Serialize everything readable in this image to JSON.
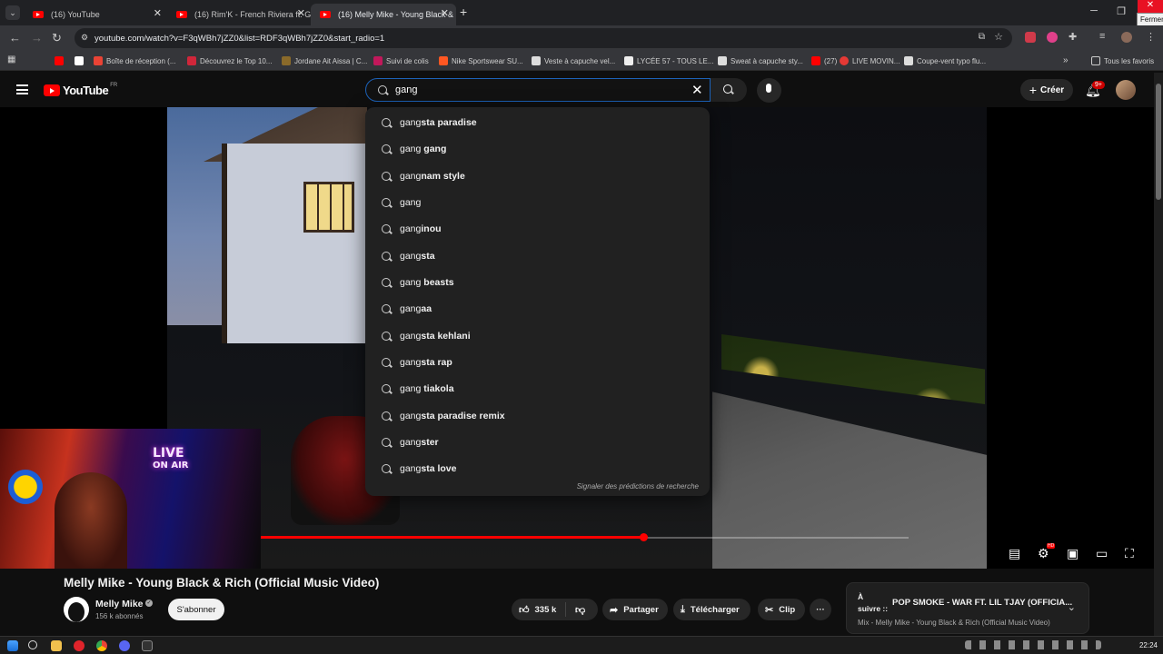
{
  "browser": {
    "tabs": [
      {
        "title": "(16) YouTube"
      },
      {
        "title": "(16) Rim'K - French Riviera ft. G"
      },
      {
        "title": "(16) Melly Mike - Young Black &"
      }
    ],
    "new_tab_symbol": "+",
    "url": "youtube.com/watch?v=F3qWBh7jZZ0&list=RDF3qWBh7jZZ0&start_radio=1",
    "close_tooltip": "Fermer",
    "bookmarks": [
      "Boîte de réception (...",
      "Découvrez le Top 10...",
      "Jordane Ait Aissa | C...",
      "Suivi de colis",
      "Nike Sportswear SU...",
      "Veste à capuche vel...",
      "LYCÉE 57 - TOUS LE...",
      "Sweat à capuche sty...",
      "(27)",
      "LIVE MOVIN...",
      "Coupe-vent typo flu..."
    ],
    "all_bookmarks": "Tous les favoris"
  },
  "youtube": {
    "logo_text": "YouTube",
    "country_code": "FR",
    "search": {
      "query": "gang",
      "suggestions": [
        {
          "typed": "gang",
          "rest": "sta paradise"
        },
        {
          "typed": "gang",
          "rest": " gang"
        },
        {
          "typed": "gang",
          "rest": "nam style"
        },
        {
          "typed": "gang",
          "rest": ""
        },
        {
          "typed": "gang",
          "rest": "inou"
        },
        {
          "typed": "gang",
          "rest": "sta"
        },
        {
          "typed": "gang",
          "rest": " beasts"
        },
        {
          "typed": "gang",
          "rest": "aa"
        },
        {
          "typed": "gang",
          "rest": "sta kehlani"
        },
        {
          "typed": "gang",
          "rest": "sta rap"
        },
        {
          "typed": "gang",
          "rest": " tiakola"
        },
        {
          "typed": "gang",
          "rest": "sta paradise remix"
        },
        {
          "typed": "gang",
          "rest": "ster"
        },
        {
          "typed": "gang",
          "rest": "sta love"
        }
      ],
      "report_text": "Signaler des prédictions de recherche"
    },
    "create_label": "Créer",
    "notif_badge": "9+",
    "webcam_sign": [
      "LIVE",
      "ON AIR"
    ],
    "player": {
      "progress_fraction": 0.59,
      "buffered_end_fraction": 1.0,
      "hd_badge": "HD"
    },
    "video": {
      "title": "Melly Mike - Young Black & Rich (Official Music Video)",
      "channel": "Melly Mike",
      "subscribers": "156 k abonnés",
      "subscribe_label": "S'abonner",
      "likes": "335 k",
      "share_label": "Partager",
      "download_label": "Télécharger",
      "clip_label": "Clip",
      "more_label": "···"
    },
    "up_next": {
      "label_line1": "À",
      "label_line2": "suivre ::",
      "title": "POP SMOKE - WAR FT. LIL TJAY (OFFICIA...",
      "subtitle": "Mix - Melly Mike - Young Black & Rich (Official Music Video)"
    }
  },
  "taskbar": {
    "time": "22:24"
  }
}
